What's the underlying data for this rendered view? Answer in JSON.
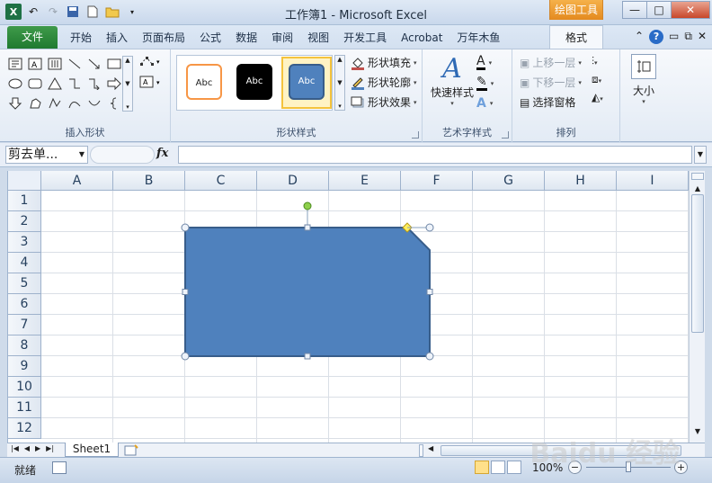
{
  "window": {
    "title": "工作簿1 - Microsoft Excel",
    "contextual_tab_group": "绘图工具",
    "buttons": {
      "minimize": "—",
      "restore": "□",
      "close": "✕"
    }
  },
  "ribbon_tabs": {
    "file": "文件",
    "items": [
      "开始",
      "插入",
      "页面布局",
      "公式",
      "数据",
      "审阅",
      "视图",
      "开发工具",
      "Acrobat",
      "万年木鱼"
    ],
    "active": "格式"
  },
  "groups": {
    "insert_shapes": {
      "label": "插入形状"
    },
    "shape_styles": {
      "label": "形状样式",
      "gallery": [
        "Abc",
        "Abc",
        "Abc"
      ],
      "commands": [
        "形状填充",
        "形状轮廓",
        "形状效果"
      ]
    },
    "wordart": {
      "label": "艺术字样式",
      "quick_styles": "快速样式"
    },
    "arrange": {
      "label": "排列",
      "commands": [
        "上移一层",
        "下移一层",
        "选择窗格"
      ]
    },
    "size": {
      "label": "大小"
    }
  },
  "formula_bar": {
    "name_box": "剪去单...",
    "fx": "fx",
    "value": ""
  },
  "grid": {
    "columns": [
      "A",
      "B",
      "C",
      "D",
      "E",
      "F",
      "G",
      "H",
      "I"
    ],
    "rows": [
      "1",
      "2",
      "3",
      "4",
      "5",
      "6",
      "7",
      "8",
      "9",
      "10",
      "11",
      "12"
    ]
  },
  "shape": {
    "type": "snip-single-corner-rectangle",
    "fill": "#4f81bd",
    "outline": "#385d8a"
  },
  "sheets": {
    "tabs": [
      "Sheet1"
    ]
  },
  "status": {
    "mode": "就绪",
    "zoom": "100%"
  },
  "watermark": "Baidu 经验",
  "colors": {
    "file_tab": "#1f7a2f",
    "contextual_tab": "#e48a1f",
    "shape_fill": "#4f81bd"
  }
}
